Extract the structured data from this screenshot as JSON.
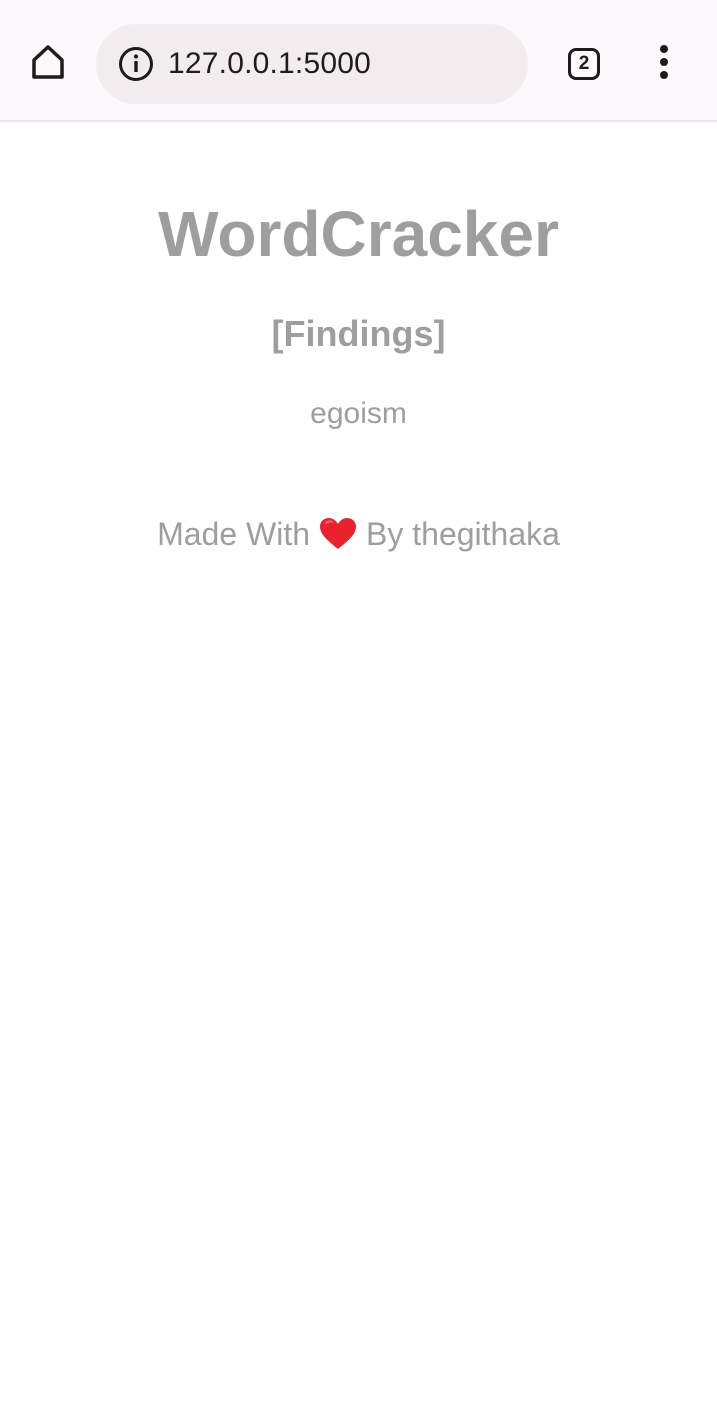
{
  "browser": {
    "url": "127.0.0.1:5000",
    "tab_count": "2",
    "icons": {
      "home": "home-icon",
      "info": "info-icon",
      "menu": "more-vert-icon"
    }
  },
  "page": {
    "title": "WordCracker",
    "subtitle": "[Findings]",
    "finding": "egoism",
    "footer": {
      "prefix": "Made With",
      "icon": "heart-icon",
      "suffix": "By thegithaka"
    }
  },
  "colors": {
    "text_gray": "#9e9e9e",
    "heart_red": "#e8232f",
    "toolbar_bg": "#fcf8fb",
    "url_bar_bg": "#f2ecee"
  }
}
